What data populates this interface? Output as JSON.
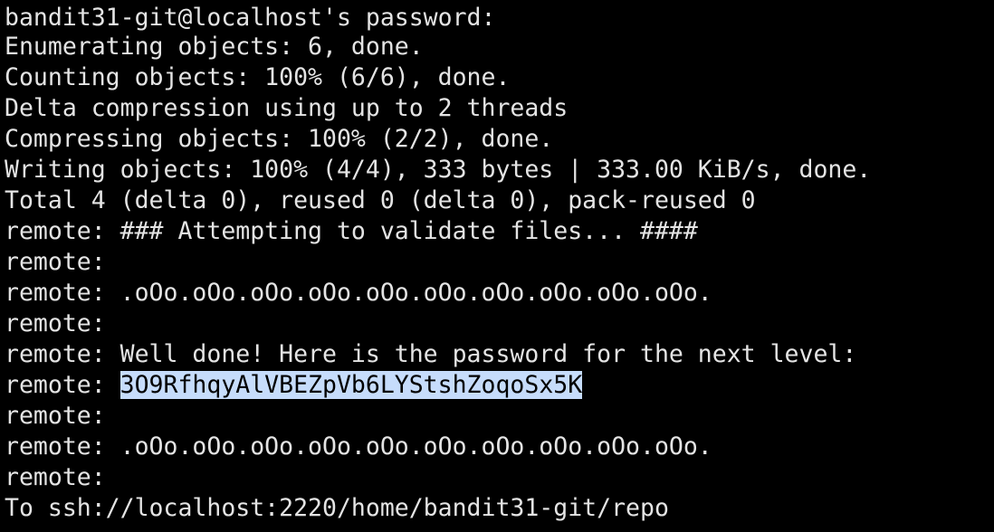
{
  "terminal": {
    "lines": [
      "bandit31-git@localhost's password:",
      "Enumerating objects: 6, done.",
      "Counting objects: 100% (6/6), done.",
      "Delta compression using up to 2 threads",
      "Compressing objects: 100% (2/2), done.",
      "Writing objects: 100% (4/4), 333 bytes | 333.00 KiB/s, done.",
      "Total 4 (delta 0), reused 0 (delta 0), pack-reused 0",
      "remote: ### Attempting to validate files... ####",
      "remote:",
      "remote: .oOo.oOo.oOo.oOo.oOo.oOo.oOo.oOo.oOo.oOo.",
      "remote:",
      "remote: Well done! Here is the password for the next level:",
      "remote: ",
      "remote:",
      "remote: .oOo.oOo.oOo.oOo.oOo.oOo.oOo.oOo.oOo.oOo.",
      "remote:",
      "To ssh://localhost:2220/home/bandit31-git/repo"
    ],
    "selected_text": "3O9RfhqyAlVBEZpVb6LYStshZoqoSx5K",
    "colors": {
      "background": "#000000",
      "foreground": "#e4e4e4",
      "selection_bg": "#c6dcfb",
      "selection_fg": "#000000"
    }
  }
}
